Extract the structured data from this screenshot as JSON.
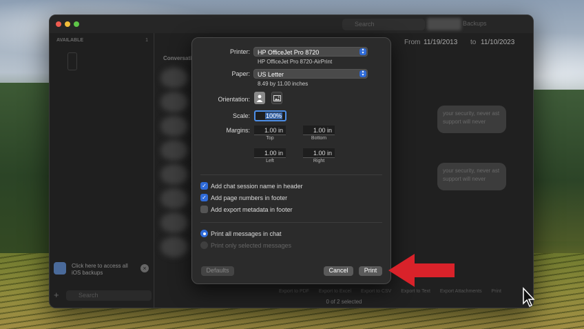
{
  "window": {
    "search_placeholder": "Search",
    "backups_label": "Backups"
  },
  "sidebar": {
    "section_label": "AVAILABLE",
    "section_count": "1",
    "promo_text": "Click here to access all iOS backups",
    "search_placeholder": "Search"
  },
  "main": {
    "list_header": "Conversati",
    "date_from_label": "From",
    "date_from": "11/19/2013",
    "date_to_label": "to",
    "date_to": "11/10/2023",
    "bubble1": "your security, never ast support will never",
    "bubble2": "your security, never ast support will never",
    "status": "0 of 2 selected",
    "toolbar": [
      "Export to PDF",
      "Export to Excel",
      "Export to CSV",
      "Export to Text",
      "Export Attachments",
      "Print"
    ]
  },
  "print_dialog": {
    "printer_label": "Printer:",
    "printer_value": "HP OfficeJet Pro 8720",
    "printer_sub": "HP OfficeJet Pro 8720-AirPrint",
    "paper_label": "Paper:",
    "paper_value": "US Letter",
    "paper_sub": "8.49 by 11.00 inches",
    "orientation_label": "Orientation:",
    "scale_label": "Scale:",
    "scale_value": "100%",
    "margins_label": "Margins:",
    "margins": {
      "top": "1.00 in",
      "top_cap": "Top",
      "bottom": "1.00 in",
      "bottom_cap": "Bottom",
      "left": "1.00 in",
      "left_cap": "Left",
      "right": "1.00 in",
      "right_cap": "Right"
    },
    "options": [
      {
        "label": "Add chat session name in header",
        "checked": true
      },
      {
        "label": "Add page numbers in footer",
        "checked": true
      },
      {
        "label": "Add export metadata in footer",
        "checked": false
      }
    ],
    "radio_all": "Print all messages in chat",
    "radio_selected": "Print only selected messages",
    "defaults_button": "Defaults",
    "cancel_button": "Cancel",
    "print_button": "Print"
  },
  "colors": {
    "accent": "#2f6bd8",
    "arrow": "#d9222a"
  }
}
